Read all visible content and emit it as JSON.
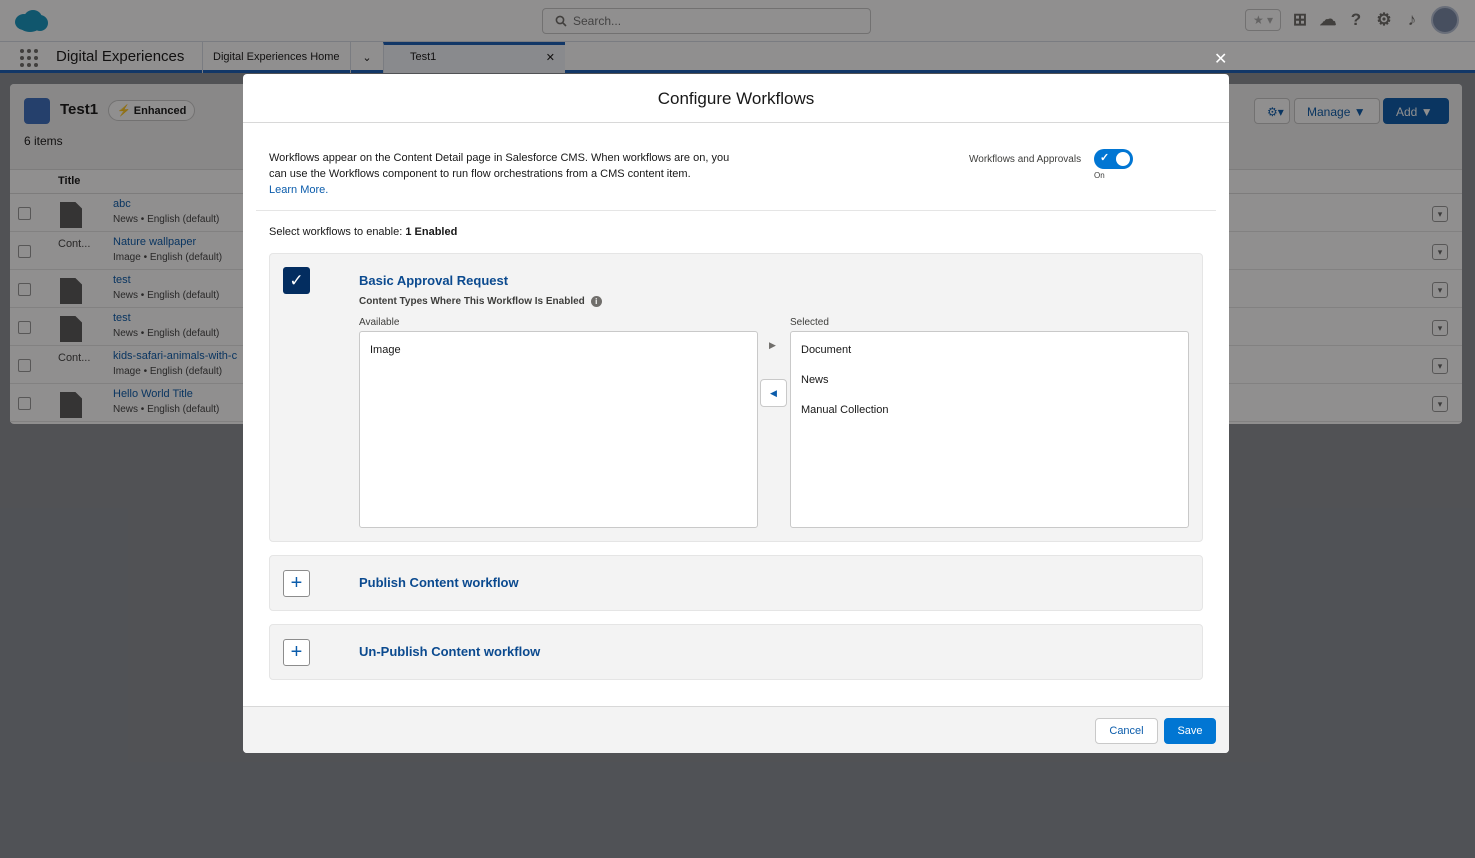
{
  "global": {
    "search_placeholder": "Search...",
    "app_name": "Digital Experiences",
    "tabs": [
      {
        "label": "Digital Experiences Home"
      },
      {
        "label": "Test1"
      }
    ]
  },
  "page": {
    "title": "Test1",
    "badge": "Enhanced",
    "count": "6 items",
    "buttons": {
      "manage": "Manage",
      "add": "Add"
    },
    "column_title": "Title",
    "rows": [
      {
        "title": "abc",
        "type": "News",
        "lang": "English (default)",
        "thumb": "doc"
      },
      {
        "title": "Nature wallpaper",
        "type": "Image",
        "lang": "English (default)",
        "thumb": "Cont..."
      },
      {
        "title": "test",
        "type": "News",
        "lang": "English (default)",
        "thumb": "doc"
      },
      {
        "title": "test",
        "type": "News",
        "lang": "English (default)",
        "thumb": "doc"
      },
      {
        "title": "kids-safari-animals-with-c",
        "type": "Image",
        "lang": "English (default)",
        "thumb": "Cont..."
      },
      {
        "title": "Hello World Title",
        "type": "News",
        "lang": "English (default)",
        "thumb": "doc"
      }
    ]
  },
  "modal": {
    "title": "Configure Workflows",
    "intro_text": "Workflows appear on the Content Detail page in Salesforce CMS. When workflows are on, you can use the Workflows component to run flow orchestrations from a CMS content item.",
    "learn_more": "Learn More.",
    "toggle_label": "Workflows and Approvals",
    "toggle_state": "On",
    "select_prefix": "Select workflows to enable:",
    "enabled_count": "1 Enabled",
    "workflows": [
      {
        "name": "Basic Approval Request",
        "content_types_label": "Content Types Where This Workflow Is Enabled",
        "available_label": "Available",
        "selected_label": "Selected",
        "available": [
          "Image"
        ],
        "selected": [
          "Document",
          "News",
          "Manual Collection"
        ]
      },
      {
        "name": "Publish Content workflow"
      },
      {
        "name": "Un-Publish Content workflow"
      }
    ],
    "cancel": "Cancel",
    "save": "Save"
  },
  "colors": {
    "brand": "#0176d3",
    "dark_blue": "#032d60",
    "link": "#0b5cab"
  },
  "icons": [
    "salesforce-cloud-icon",
    "search-icon",
    "favorite-star-icon",
    "add-icon",
    "trailhead-icon",
    "help-icon",
    "setup-gear-icon",
    "notification-bell-icon",
    "app-launcher-icon",
    "close-icon",
    "checkbox-checked-icon",
    "plus-icon",
    "info-icon",
    "move-right-icon",
    "move-left-icon"
  ]
}
